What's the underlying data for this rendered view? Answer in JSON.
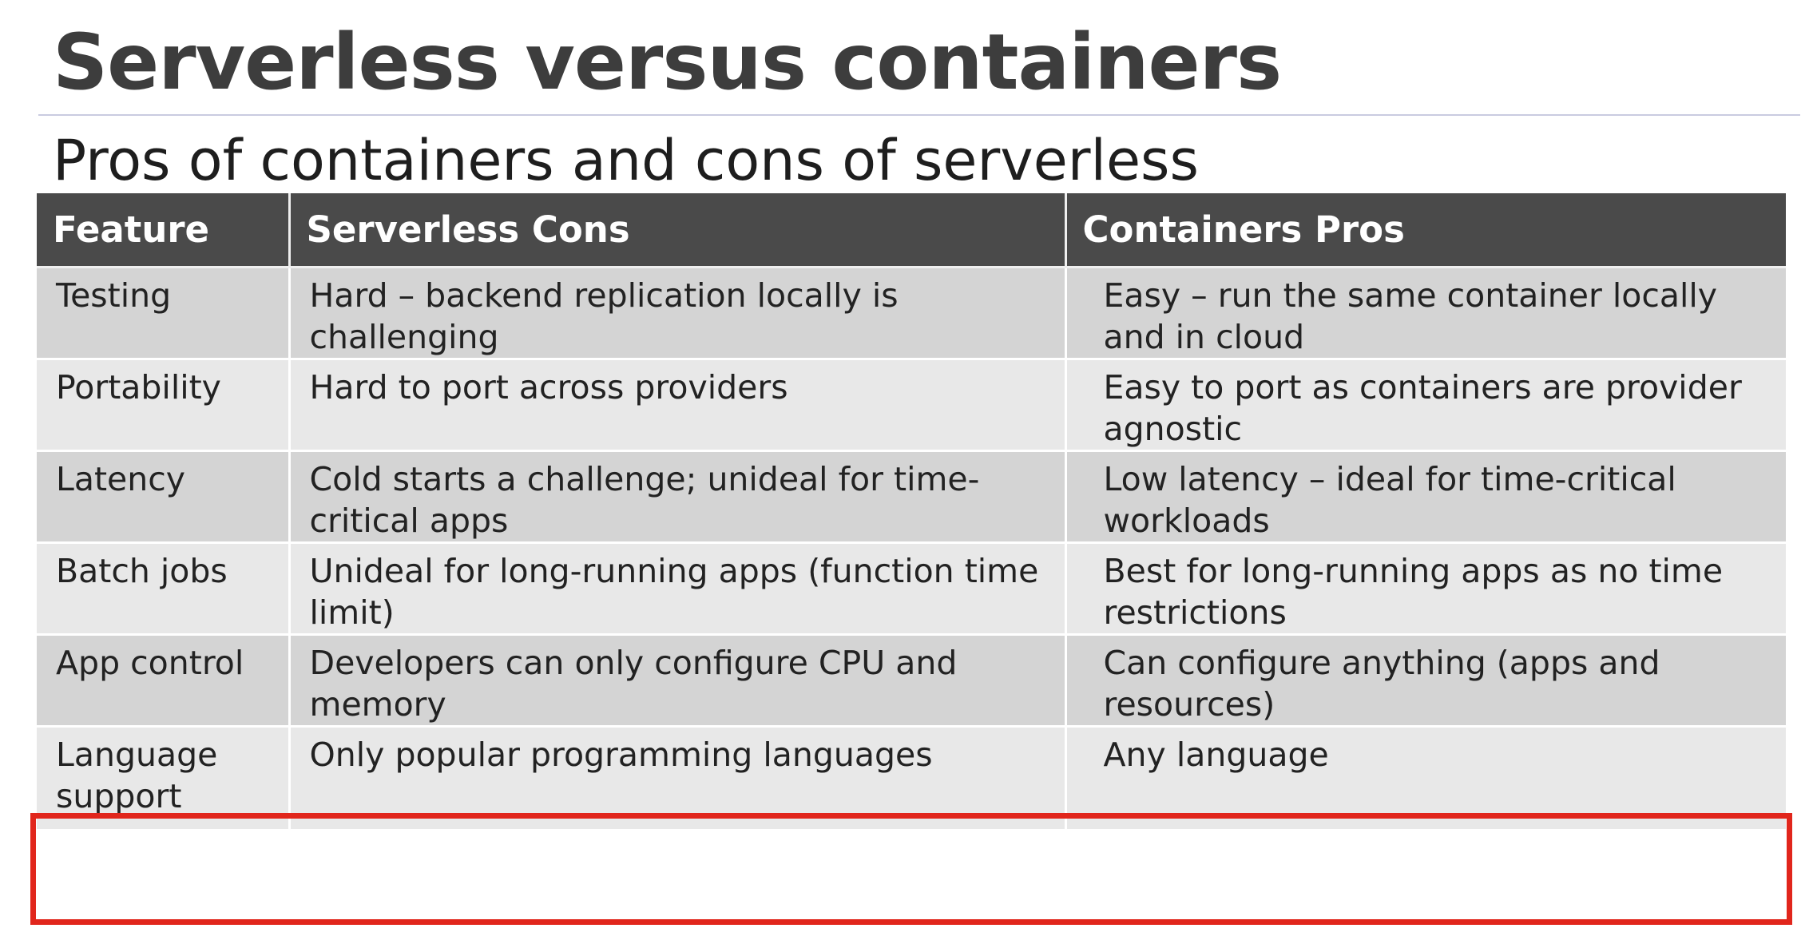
{
  "slide": {
    "title": "Serverless versus containers",
    "subtitle": "Pros of containers and cons of serverless"
  },
  "table": {
    "headers": [
      "Feature",
      "Serverless Cons",
      "Containers Pros"
    ],
    "rows": [
      {
        "feature": "Testing",
        "serverless_cons": "Hard – backend replication locally is challenging",
        "containers_pros": "Easy – run the same container locally and in cloud"
      },
      {
        "feature": "Portability",
        "serverless_cons": "Hard to port across providers",
        "containers_pros": "Easy to port as containers are provider agnostic"
      },
      {
        "feature": "Latency",
        "serverless_cons": "Cold starts a challenge; unideal for time-critical apps",
        "containers_pros": "Low latency – ideal for time-critical workloads"
      },
      {
        "feature": "Batch jobs",
        "serverless_cons": "Unideal for long-running apps (function time limit)",
        "containers_pros": "Best for long-running apps as no time restrictions"
      },
      {
        "feature": "App control",
        "serverless_cons": "Developers can only configure CPU and memory",
        "containers_pros": "Can configure anything (apps and resources)"
      },
      {
        "feature": "Language support",
        "serverless_cons": "Only popular programming languages",
        "containers_pros": "Any language"
      }
    ]
  },
  "colors": {
    "header_bg": "#4a4a4a",
    "row_dark": "#d4d4d4",
    "row_light": "#e8e8e8",
    "highlight": "#e1261c"
  }
}
